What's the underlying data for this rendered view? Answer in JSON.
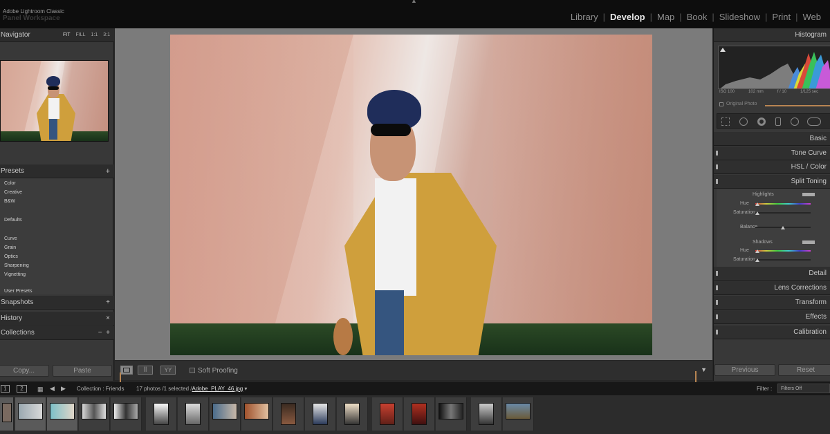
{
  "app": {
    "name": "Adobe Lightroom Classic",
    "catalog": "Panel Workspace"
  },
  "modules": [
    "Library",
    "Develop",
    "Map",
    "Book",
    "Slideshow",
    "Print",
    "Web"
  ],
  "active_module": "Develop",
  "left_panel": {
    "navigator": {
      "title": "Navigator",
      "zoom_options": [
        "FIT",
        "FILL",
        "1:1",
        "3:1"
      ]
    },
    "presets": {
      "title": "Presets",
      "items": [
        "Color",
        "Creative",
        "B&W",
        "Defaults",
        "Curve",
        "Grain",
        "Optics",
        "Sharpening",
        "Vignetting",
        "User Presets"
      ]
    },
    "snapshots": "Snapshots",
    "history": "History",
    "collections": "Collections",
    "copy_label": "Copy...",
    "paste_label": "Paste"
  },
  "toolbar": {
    "soft_proofing": "Soft Proofing"
  },
  "right_panel": {
    "histogram": {
      "title": "Histogram",
      "iso": "ISO 100",
      "focal": "102 mm",
      "aperture": "f / 10",
      "shutter": "1/125 sec",
      "original_photo": "Original Photo"
    },
    "sections": [
      "Basic",
      "Tone Curve",
      "HSL / Color",
      "Split Toning",
      "Detail",
      "Lens Corrections",
      "Transform",
      "Effects",
      "Calibration"
    ],
    "split_toning": {
      "highlights": "Highlights",
      "hue": "Hue",
      "saturation": "Saturation",
      "balance": "Balance",
      "shadows": "Shadows"
    },
    "previous_label": "Previous",
    "reset_label": "Reset"
  },
  "filmstrip": {
    "collection": "Collection : Friends",
    "count": "17 photos /1 selected /",
    "filename": "Adobe_PLAY_46.jpg",
    "filter_label": "Filter :",
    "filter_value": "Filters Off",
    "page1": "1",
    "page2": "2"
  }
}
